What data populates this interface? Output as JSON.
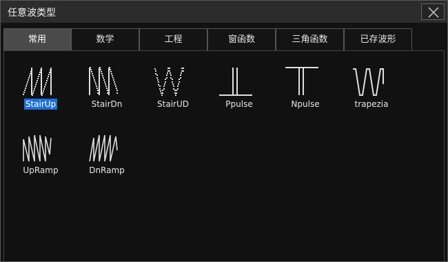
{
  "window": {
    "title": "任意波类型"
  },
  "tabs": [
    {
      "label": "常用",
      "active": true
    },
    {
      "label": "数学",
      "active": false
    },
    {
      "label": "工程",
      "active": false
    },
    {
      "label": "窗函数",
      "active": false
    },
    {
      "label": "三角函数",
      "active": false
    },
    {
      "label": "已存波形",
      "active": false
    }
  ],
  "waveforms": [
    {
      "label": "StairUp",
      "icon": "stair-up-wave-icon",
      "selected": true
    },
    {
      "label": "StairDn",
      "icon": "stair-down-wave-icon",
      "selected": false
    },
    {
      "label": "StairUD",
      "icon": "stair-updown-wave-icon",
      "selected": false
    },
    {
      "label": "Ppulse",
      "icon": "positive-pulse-icon",
      "selected": false
    },
    {
      "label": "Npulse",
      "icon": "negative-pulse-icon",
      "selected": false
    },
    {
      "label": "trapezia",
      "icon": "trapezia-wave-icon",
      "selected": false
    },
    {
      "label": "UpRamp",
      "icon": "up-ramp-wave-icon",
      "selected": false
    },
    {
      "label": "DnRamp",
      "icon": "down-ramp-wave-icon",
      "selected": false
    }
  ],
  "colors": {
    "selection": "#1f6fd6",
    "active_tab": "#4a4a4a",
    "titlebar": "#2c2c2c"
  }
}
